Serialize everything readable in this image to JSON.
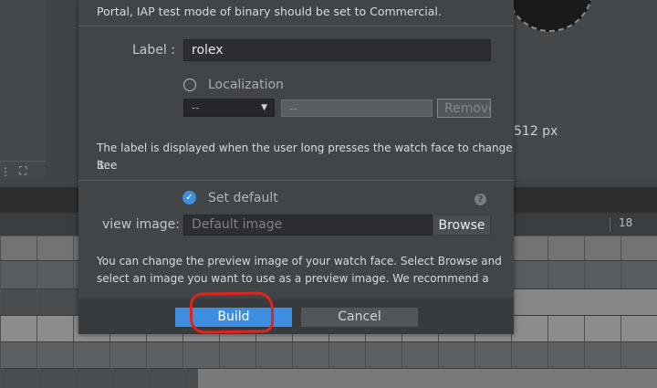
{
  "dialog": {
    "notice_text": "Portal, IAP test mode of binary should be set to Commercial.",
    "label_caption": "Label :",
    "label_value": "rolex",
    "localization_label": "Localization",
    "localization_select_value": "--",
    "localization_text_value": "--",
    "remove_label": "Remove",
    "label_help_line1": "The label is displayed when the user long presses the watch face to change it.",
    "label_help_line2": "See",
    "set_default_label": "Set default",
    "help_glyph": "?",
    "preview_caption": "view image:",
    "preview_placeholder": "Default image",
    "browse_label": "Browse",
    "preview_help_line1": "You can change the preview image of your watch face. Select Browse and",
    "preview_help_line2": "select an image you want to use as a preview image. We recommend a",
    "build_label": "Build",
    "cancel_label": "Cancel"
  },
  "background": {
    "size_label": "512 px",
    "ruler_number": "18"
  },
  "colors": {
    "accent": "#3d8ee0",
    "annotation": "#e0231b"
  }
}
